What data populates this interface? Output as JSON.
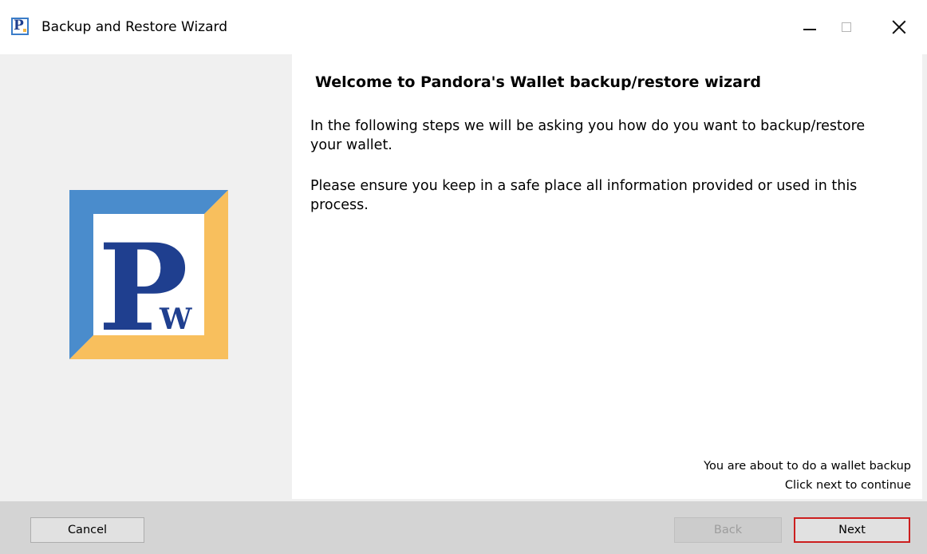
{
  "window": {
    "title": "Backup and Restore Wizard",
    "icon": "pandora-wallet-app-icon",
    "icon_letter": "P"
  },
  "window_controls": {
    "minimize_icon": "minimize-icon",
    "maximize_icon": "maximize-icon",
    "close_icon": "close-icon"
  },
  "logo": {
    "letter_main": "P",
    "letter_sub": "W",
    "colors": {
      "blue": "#4a8ccc",
      "gold": "#f8bf5d",
      "navy": "#1f3f8f"
    }
  },
  "content": {
    "heading": "Welcome to Pandora's Wallet backup/restore wizard",
    "paragraph_1": "In the following steps we will be asking you how do you want to backup/restore your wallet.",
    "paragraph_2": "Please ensure you keep in a safe place all information provided or used in this process.",
    "status_line_1": "You are about to do a wallet backup",
    "status_line_2": "Click next to continue"
  },
  "buttons": {
    "cancel_label": "Cancel",
    "back_label": "Back",
    "next_label": "Next"
  },
  "colors": {
    "next_highlight": "#cc1e1e"
  }
}
